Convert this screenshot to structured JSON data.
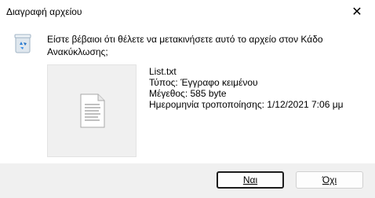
{
  "window": {
    "title": "Διαγραφή αρχείου",
    "close_glyph": "✕"
  },
  "message": {
    "line1": "Είστε βέβαιοι ότι θέλετε να μετακινήσετε αυτό το αρχείο στον Κάδο",
    "line2": "Ανακύκλωσης;"
  },
  "file": {
    "name": "List.txt",
    "type": "Τύπος: Έγγραφο κειμένου",
    "size": "Μέγεθος: 585 byte",
    "modified": "Ημερομηνία τροποποίησης: 1/12/2021 7:06 μμ"
  },
  "buttons": {
    "yes_label": "Ναι",
    "no_label": "Όχι"
  },
  "icons": {
    "recycle": "recycle-bin-icon",
    "document": "text-document-icon",
    "close": "close-icon"
  },
  "colors": {
    "footer_bg": "#f0f0f0",
    "thumb_bg": "#f0f0f0",
    "default_button_border": "#1c1c1c"
  }
}
